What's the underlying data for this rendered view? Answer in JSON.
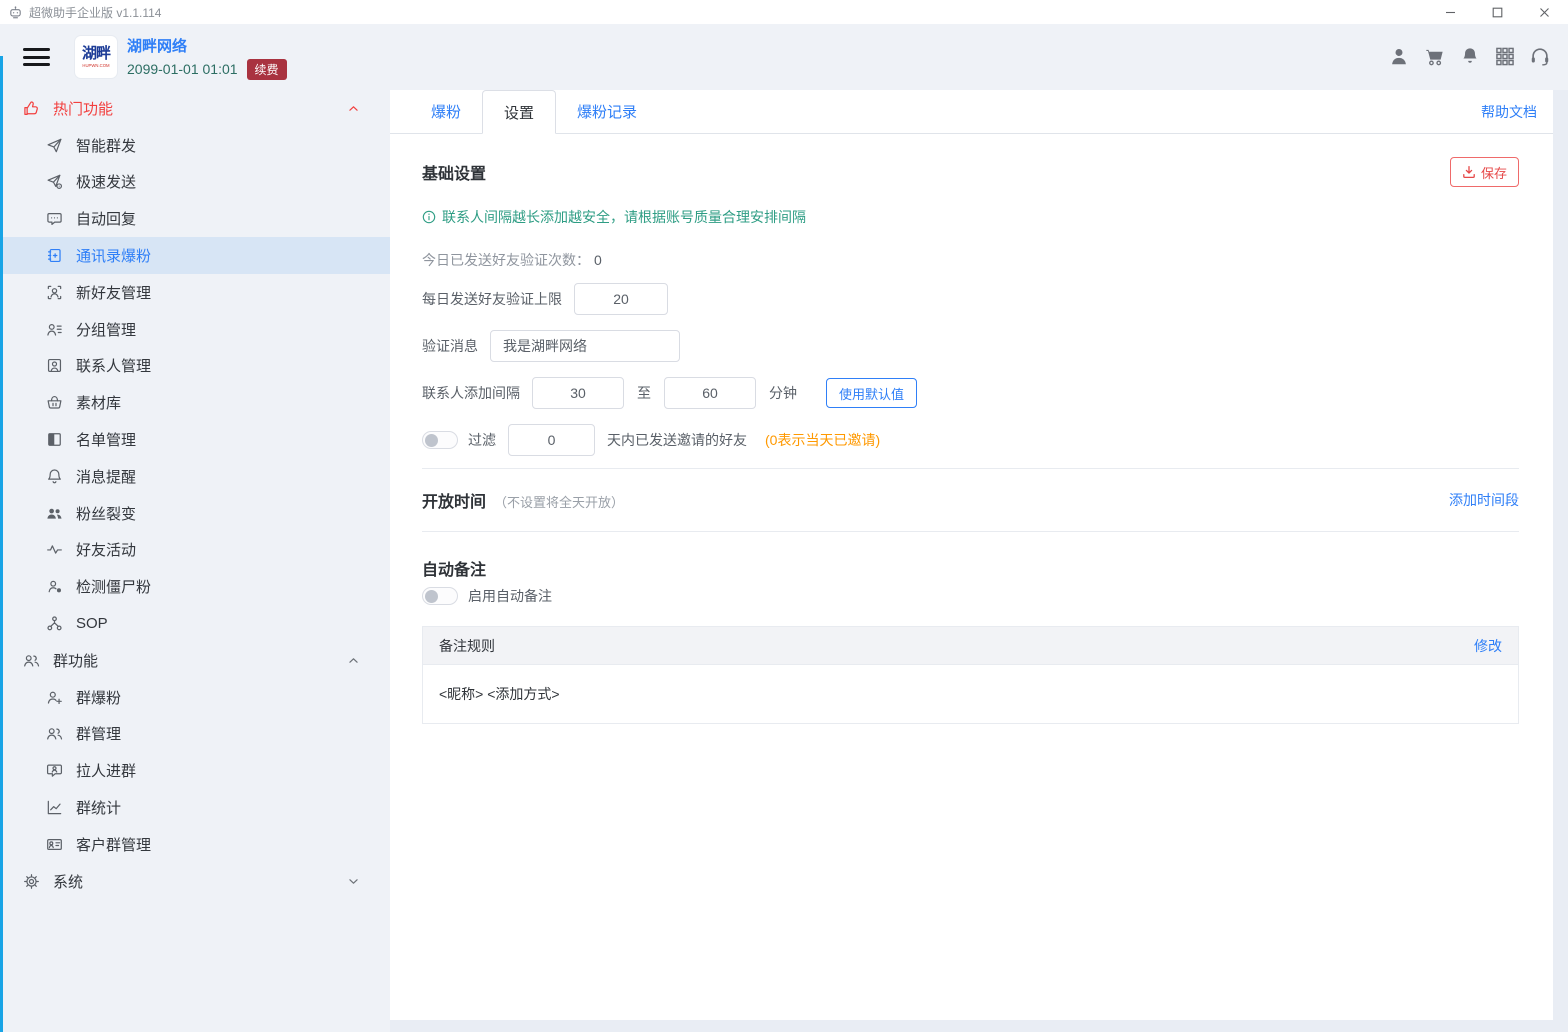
{
  "titlebar": {
    "app_title": "超微助手企业版 v1.1.114",
    "controls": [
      "minimize",
      "maximize",
      "close"
    ]
  },
  "header": {
    "logo_text": "湖畔",
    "logo_sub": "HUPWN.COM",
    "company": "湖畔网络",
    "datetime": "2099-01-01 01:01",
    "renew_label": "续费",
    "toolbar_icons": [
      "user",
      "cart",
      "bell",
      "apps",
      "headset"
    ]
  },
  "sidebar": {
    "sections": [
      {
        "key": "hot-functions",
        "label": "热门功能",
        "icon": "thumb-up",
        "accent": true,
        "expanded": true,
        "items": [
          {
            "key": "smart-bulk-send",
            "label": "智能群发",
            "icon": "send"
          },
          {
            "key": "fast-send",
            "label": "极速发送",
            "icon": "send-gear"
          },
          {
            "key": "auto-reply",
            "label": "自动回复",
            "icon": "chat"
          },
          {
            "key": "contacts-fan-boost",
            "label": "通讯录爆粉",
            "icon": "book-plus",
            "active": true
          },
          {
            "key": "new-friend-manage",
            "label": "新好友管理",
            "icon": "user-frame"
          },
          {
            "key": "group-manage",
            "label": "分组管理",
            "icon": "user-list"
          },
          {
            "key": "contact-manage",
            "label": "联系人管理",
            "icon": "user-square"
          },
          {
            "key": "material-library",
            "label": "素材库",
            "icon": "basket"
          },
          {
            "key": "list-manage",
            "label": "名单管理",
            "icon": "square-half"
          },
          {
            "key": "message-remind",
            "label": "消息提醒",
            "icon": "bell16"
          },
          {
            "key": "fan-fission",
            "label": "粉丝裂变",
            "icon": "users-filled"
          },
          {
            "key": "friend-activity",
            "label": "好友活动",
            "icon": "pulse"
          },
          {
            "key": "zombie-fan-check",
            "label": "检测僵尸粉",
            "icon": "user-dot"
          },
          {
            "key": "sop",
            "label": "SOP",
            "icon": "sop"
          }
        ]
      },
      {
        "key": "group-functions",
        "label": "群功能",
        "icon": "users",
        "expanded": true,
        "items": [
          {
            "key": "group-fan-boost",
            "label": "群爆粉",
            "icon": "user-plus"
          },
          {
            "key": "group-management",
            "label": "群管理",
            "icon": "users"
          },
          {
            "key": "pull-into-group",
            "label": "拉人进群",
            "icon": "chat-user"
          },
          {
            "key": "group-stats",
            "label": "群统计",
            "icon": "chart"
          },
          {
            "key": "customer-group-manage",
            "label": "客户群管理",
            "icon": "id-card"
          }
        ]
      },
      {
        "key": "system",
        "label": "系统",
        "icon": "gear",
        "expanded": false,
        "items": []
      }
    ]
  },
  "main": {
    "tabs": [
      {
        "key": "fan-boost",
        "label": "爆粉"
      },
      {
        "key": "settings",
        "label": "设置",
        "active": true
      },
      {
        "key": "fan-records",
        "label": "爆粉记录"
      }
    ],
    "help_link": "帮助文档",
    "basic": {
      "title": "基础设置",
      "save_label": "保存",
      "info": "联系人间隔越长添加越安全，请根据账号质量合理安排间隔",
      "sent_today_label": "今日已发送好友验证次数：",
      "sent_today_value": "0",
      "daily_limit_label": "每日发送好友验证上限",
      "daily_limit_value": "20",
      "verify_msg_label": "验证消息",
      "verify_msg_value": "我是湖畔网络",
      "interval_label": "联系人添加间隔",
      "interval_from": "30",
      "interval_to_label": "至",
      "interval_to": "60",
      "interval_unit": "分钟",
      "default_btn_label": "使用默认值",
      "filter_label": "过滤",
      "filter_days_value": "0",
      "filter_suffix": "天内已发送邀请的好友",
      "filter_hint": "(0表示当天已邀请)"
    },
    "open_time": {
      "title": "开放时间",
      "hint": "（不设置将全天开放）",
      "add_link": "添加时间段"
    },
    "auto_note": {
      "title": "自动备注",
      "toggle_label": "启用自动备注",
      "table": {
        "header": "备注规则",
        "edit_link": "修改",
        "row": "<昵称> <添加方式>"
      }
    }
  }
}
